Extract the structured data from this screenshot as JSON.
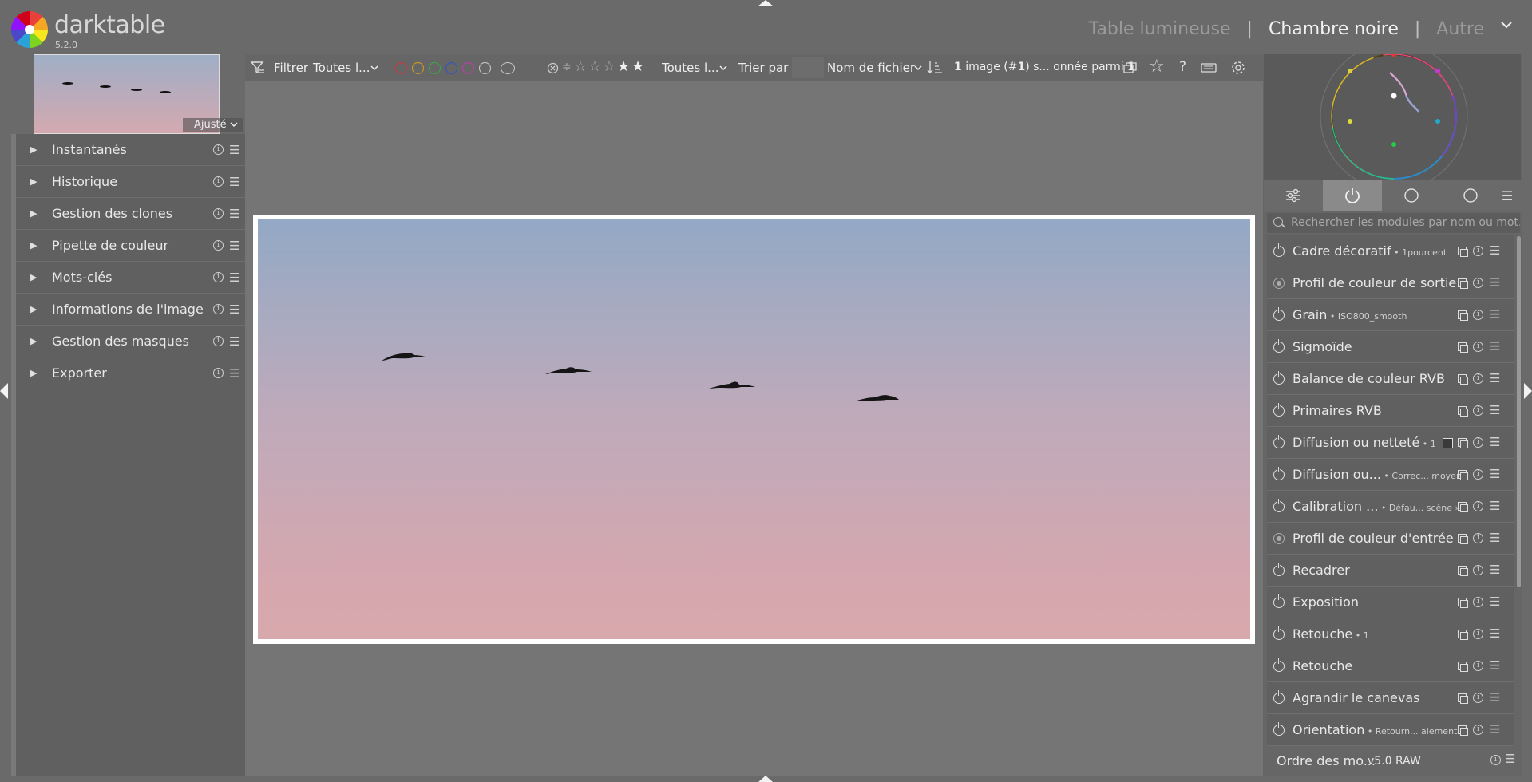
{
  "app": {
    "name": "darktable",
    "version": "5.2.0"
  },
  "views": {
    "lighttable": "Table lumineuse",
    "darkroom": "Chambre noire",
    "other": "Autre",
    "sep": "|"
  },
  "navigation": {
    "zoom_label": "Ajusté"
  },
  "left_modules": [
    {
      "label": "Instantanés"
    },
    {
      "label": "Historique"
    },
    {
      "label": "Gestion des clones"
    },
    {
      "label": "Pipette de couleur"
    },
    {
      "label": "Mots-clés"
    },
    {
      "label": "Informations de l'image"
    },
    {
      "label": "Gestion des masques"
    },
    {
      "label": "Exporter"
    }
  ],
  "toolbar": {
    "filter_label": "Filtrer",
    "filter_value": "Toutes l...",
    "rating_value": "Toutes l...",
    "sort_label": "Trier par",
    "sort_value": "Nom de fichier",
    "count_text_1": "1",
    "count_text_2": " image (#",
    "count_text_3": "1",
    "count_text_4": ") s... onnée parmi ",
    "count_text_5": "1"
  },
  "color_labels": [
    "#d0343a",
    "#d6a21e",
    "#3aa84a",
    "#2f52d0",
    "#c53ab4",
    "#cccccc"
  ],
  "right_panel": {
    "search_placeholder": "Rechercher les modules par nom ou mot...",
    "modules": [
      {
        "name": "Cadre décoratif",
        "sub": " • 1pourcent",
        "on": true
      },
      {
        "name": "Profil de couleur de sortie",
        "sub": "",
        "on": false
      },
      {
        "name": "Grain",
        "sub": " • ISO800_smooth",
        "on": true
      },
      {
        "name": "Sigmoïde",
        "sub": "",
        "on": true
      },
      {
        "name": "Balance de couleur RVB",
        "sub": "",
        "on": true
      },
      {
        "name": "Primaires RVB",
        "sub": "",
        "on": true
      },
      {
        "name": "Diffusion ou netteté",
        "sub": " • 1",
        "on": true,
        "mask": true
      },
      {
        "name": "Diffusion ou...",
        "sub": " • Correc... moyen",
        "on": true
      },
      {
        "name": "Calibration ...",
        "sub": " • Défau... scène »",
        "on": true
      },
      {
        "name": "Profil de couleur d'entrée",
        "sub": "",
        "on": false
      },
      {
        "name": "Recadrer",
        "sub": "",
        "on": true
      },
      {
        "name": "Exposition",
        "sub": "",
        "on": true
      },
      {
        "name": "Retouche",
        "sub": " • 1",
        "on": true
      },
      {
        "name": "Retouche",
        "sub": "",
        "on": true
      },
      {
        "name": "Agrandir le canevas",
        "sub": "",
        "on": true
      },
      {
        "name": "Orientation",
        "sub": " • Retourn... alement",
        "on": true
      }
    ],
    "footer_label": "Ordre des mo...",
    "footer_value": " v5.0 RAW"
  },
  "icons": {
    "info": "i",
    "menu": "☰",
    "triangle": "▶",
    "chevron": "⌄"
  }
}
